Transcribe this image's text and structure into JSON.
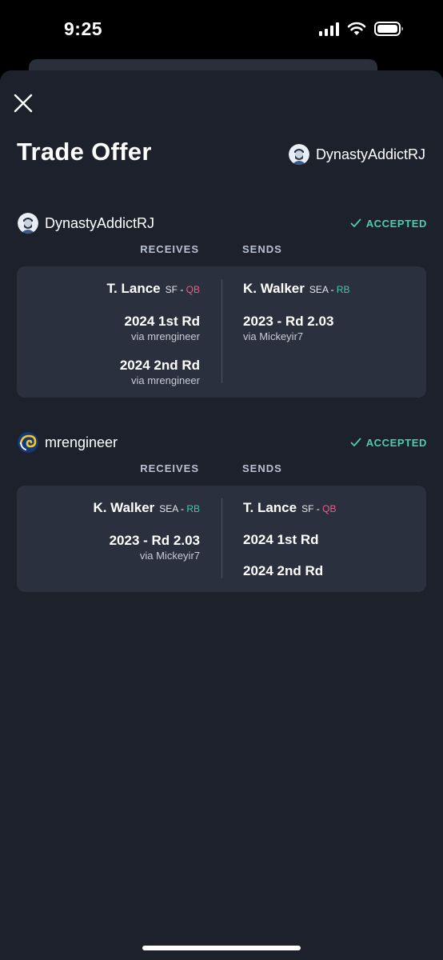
{
  "status_bar": {
    "time": "9:25"
  },
  "header": {
    "title": "Trade Offer",
    "user": "DynastyAddictRJ"
  },
  "sections": [
    {
      "user": "DynastyAddictRJ",
      "status": "ACCEPTED",
      "receives_label": "RECEIVES",
      "sends_label": "SENDS",
      "receives": [
        {
          "name": "T. Lance",
          "team": "SF",
          "pos": "QB"
        },
        {
          "name": "2024 1st Rd",
          "via": "via mrengineer"
        },
        {
          "name": "2024 2nd Rd",
          "via": "via mrengineer"
        }
      ],
      "sends": [
        {
          "name": "K. Walker",
          "team": "SEA",
          "pos": "RB"
        },
        {
          "name": "2023 - Rd 2.03",
          "via": "via Mickeyir7"
        }
      ]
    },
    {
      "user": "mrengineer",
      "status": "ACCEPTED",
      "receives_label": "RECEIVES",
      "sends_label": "SENDS",
      "receives": [
        {
          "name": "K. Walker",
          "team": "SEA",
          "pos": "RB"
        },
        {
          "name": "2023 - Rd 2.03",
          "via": "via Mickeyir7"
        }
      ],
      "sends": [
        {
          "name": "T. Lance",
          "team": "SF",
          "pos": "QB"
        },
        {
          "name": "2024 1st Rd"
        },
        {
          "name": "2024 2nd Rd"
        }
      ]
    }
  ],
  "icons": {
    "close": "close-icon",
    "check": "check-icon",
    "avatar_user1": "bearded-man-avatar",
    "avatar_user2": "rams-logo-avatar"
  },
  "colors": {
    "background": "#1c212c",
    "card": "#2a303d",
    "accepted": "#49cfae",
    "qb": "#ef5a8a",
    "rb": "#43c8a6"
  }
}
